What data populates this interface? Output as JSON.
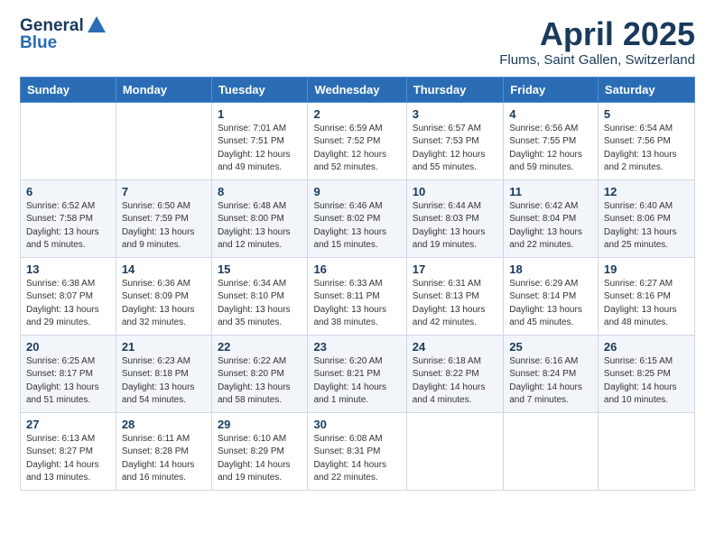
{
  "header": {
    "logo_line1": "General",
    "logo_line2": "Blue",
    "main_title": "April 2025",
    "subtitle": "Flums, Saint Gallen, Switzerland"
  },
  "weekdays": [
    "Sunday",
    "Monday",
    "Tuesday",
    "Wednesday",
    "Thursday",
    "Friday",
    "Saturday"
  ],
  "weeks": [
    [
      {
        "day": "",
        "info": ""
      },
      {
        "day": "",
        "info": ""
      },
      {
        "day": "1",
        "info": "Sunrise: 7:01 AM\nSunset: 7:51 PM\nDaylight: 12 hours and 49 minutes."
      },
      {
        "day": "2",
        "info": "Sunrise: 6:59 AM\nSunset: 7:52 PM\nDaylight: 12 hours and 52 minutes."
      },
      {
        "day": "3",
        "info": "Sunrise: 6:57 AM\nSunset: 7:53 PM\nDaylight: 12 hours and 55 minutes."
      },
      {
        "day": "4",
        "info": "Sunrise: 6:56 AM\nSunset: 7:55 PM\nDaylight: 12 hours and 59 minutes."
      },
      {
        "day": "5",
        "info": "Sunrise: 6:54 AM\nSunset: 7:56 PM\nDaylight: 13 hours and 2 minutes."
      }
    ],
    [
      {
        "day": "6",
        "info": "Sunrise: 6:52 AM\nSunset: 7:58 PM\nDaylight: 13 hours and 5 minutes."
      },
      {
        "day": "7",
        "info": "Sunrise: 6:50 AM\nSunset: 7:59 PM\nDaylight: 13 hours and 9 minutes."
      },
      {
        "day": "8",
        "info": "Sunrise: 6:48 AM\nSunset: 8:00 PM\nDaylight: 13 hours and 12 minutes."
      },
      {
        "day": "9",
        "info": "Sunrise: 6:46 AM\nSunset: 8:02 PM\nDaylight: 13 hours and 15 minutes."
      },
      {
        "day": "10",
        "info": "Sunrise: 6:44 AM\nSunset: 8:03 PM\nDaylight: 13 hours and 19 minutes."
      },
      {
        "day": "11",
        "info": "Sunrise: 6:42 AM\nSunset: 8:04 PM\nDaylight: 13 hours and 22 minutes."
      },
      {
        "day": "12",
        "info": "Sunrise: 6:40 AM\nSunset: 8:06 PM\nDaylight: 13 hours and 25 minutes."
      }
    ],
    [
      {
        "day": "13",
        "info": "Sunrise: 6:38 AM\nSunset: 8:07 PM\nDaylight: 13 hours and 29 minutes."
      },
      {
        "day": "14",
        "info": "Sunrise: 6:36 AM\nSunset: 8:09 PM\nDaylight: 13 hours and 32 minutes."
      },
      {
        "day": "15",
        "info": "Sunrise: 6:34 AM\nSunset: 8:10 PM\nDaylight: 13 hours and 35 minutes."
      },
      {
        "day": "16",
        "info": "Sunrise: 6:33 AM\nSunset: 8:11 PM\nDaylight: 13 hours and 38 minutes."
      },
      {
        "day": "17",
        "info": "Sunrise: 6:31 AM\nSunset: 8:13 PM\nDaylight: 13 hours and 42 minutes."
      },
      {
        "day": "18",
        "info": "Sunrise: 6:29 AM\nSunset: 8:14 PM\nDaylight: 13 hours and 45 minutes."
      },
      {
        "day": "19",
        "info": "Sunrise: 6:27 AM\nSunset: 8:16 PM\nDaylight: 13 hours and 48 minutes."
      }
    ],
    [
      {
        "day": "20",
        "info": "Sunrise: 6:25 AM\nSunset: 8:17 PM\nDaylight: 13 hours and 51 minutes."
      },
      {
        "day": "21",
        "info": "Sunrise: 6:23 AM\nSunset: 8:18 PM\nDaylight: 13 hours and 54 minutes."
      },
      {
        "day": "22",
        "info": "Sunrise: 6:22 AM\nSunset: 8:20 PM\nDaylight: 13 hours and 58 minutes."
      },
      {
        "day": "23",
        "info": "Sunrise: 6:20 AM\nSunset: 8:21 PM\nDaylight: 14 hours and 1 minute."
      },
      {
        "day": "24",
        "info": "Sunrise: 6:18 AM\nSunset: 8:22 PM\nDaylight: 14 hours and 4 minutes."
      },
      {
        "day": "25",
        "info": "Sunrise: 6:16 AM\nSunset: 8:24 PM\nDaylight: 14 hours and 7 minutes."
      },
      {
        "day": "26",
        "info": "Sunrise: 6:15 AM\nSunset: 8:25 PM\nDaylight: 14 hours and 10 minutes."
      }
    ],
    [
      {
        "day": "27",
        "info": "Sunrise: 6:13 AM\nSunset: 8:27 PM\nDaylight: 14 hours and 13 minutes."
      },
      {
        "day": "28",
        "info": "Sunrise: 6:11 AM\nSunset: 8:28 PM\nDaylight: 14 hours and 16 minutes."
      },
      {
        "day": "29",
        "info": "Sunrise: 6:10 AM\nSunset: 8:29 PM\nDaylight: 14 hours and 19 minutes."
      },
      {
        "day": "30",
        "info": "Sunrise: 6:08 AM\nSunset: 8:31 PM\nDaylight: 14 hours and 22 minutes."
      },
      {
        "day": "",
        "info": ""
      },
      {
        "day": "",
        "info": ""
      },
      {
        "day": "",
        "info": ""
      }
    ]
  ]
}
